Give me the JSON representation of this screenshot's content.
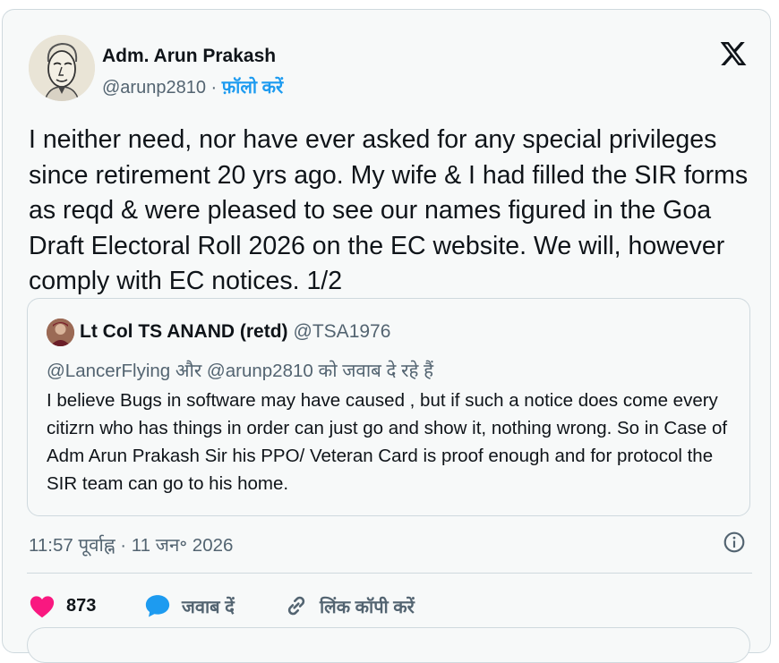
{
  "author": {
    "display_name": "Adm. Arun Prakash",
    "handle": "@arunp2810",
    "separator": "·",
    "follow_label": "फ़ॉलो करें"
  },
  "tweet": {
    "text": "I neither need, nor have ever asked for any special privileges since retirement 20 yrs ago. My wife & I had filled the SIR forms as reqd & were pleased to see our names figured in the Goa Draft Electoral Roll 2026 on the EC website. We will, however comply with EC notices. 1/2"
  },
  "quote": {
    "display_name": "Lt Col TS ANAND (retd)",
    "handle": "@TSA1976",
    "replying_to": "@LancerFlying और @arunp2810 को जवाब दे रहे हैं",
    "text": "I believe Bugs in software may have caused , but if such a notice does come every citizrn who has things in order can just go and show it, nothing wrong. So in Case of Adm Arun Prakash Sir his PPO/ Veteran Card is proof enough and for protocol the SIR team can go to his home."
  },
  "timestamp": "11:57 पूर्वाह्न · 11 जन॰ 2026",
  "actions": {
    "like_count": "873",
    "reply_label": "जवाब दें",
    "copy_link_label": "लिंक कॉपी करें"
  },
  "icons": {
    "logo": "x-logo-icon",
    "info": "info-icon",
    "like": "heart-icon",
    "reply": "speech-bubble-icon",
    "copy_link": "link-icon"
  },
  "colors": {
    "accent": "#1d9bf0",
    "like": "#f91880",
    "text": "#0f1419",
    "secondary": "#536471",
    "border": "#cfd9de",
    "background": "#f7f9f9"
  }
}
